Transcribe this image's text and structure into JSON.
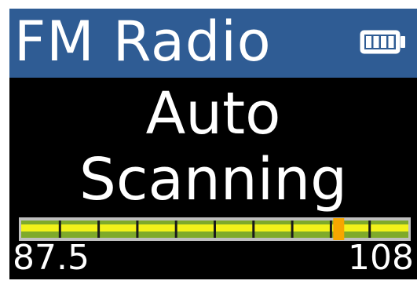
{
  "app": {
    "title": "FM Radio"
  },
  "status": {
    "line1": "Auto",
    "line2": "Scanning"
  },
  "battery": {
    "icon": "battery-full-icon",
    "level": 1.0
  },
  "tuner": {
    "min_label": "87.5",
    "max_label": "108",
    "min_mhz": 87.5,
    "max_mhz": 108,
    "scan_position_fraction": 0.82
  },
  "colors": {
    "title_bar": "#2f5c94",
    "screen_bg": "#000000",
    "text": "#ffffff",
    "track_fill": "#f2f21a",
    "track_edge": "#8ab82e",
    "track_border": "#bfbfbf",
    "indicator": "#f7a600"
  }
}
